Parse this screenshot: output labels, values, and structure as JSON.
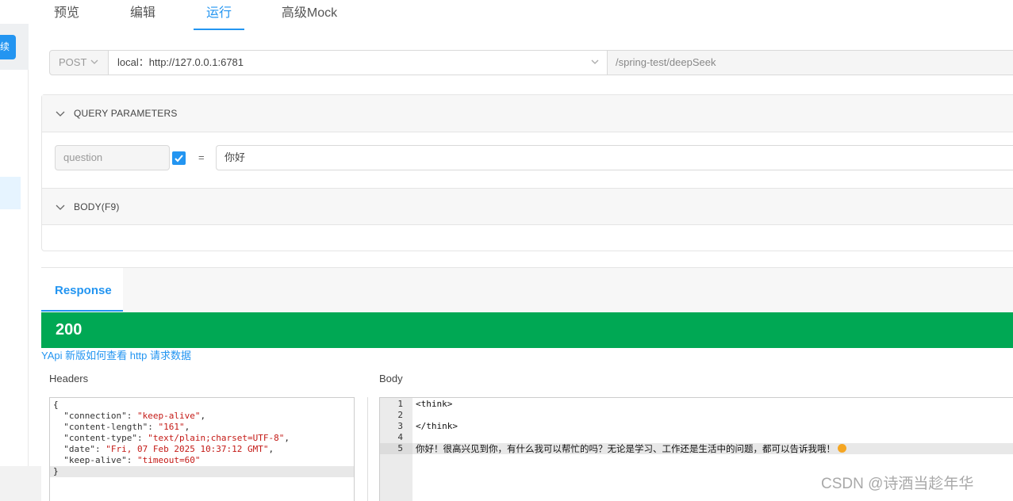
{
  "sidebar": {
    "button_label": "续"
  },
  "tabs": [
    {
      "label": "预览"
    },
    {
      "label": "编辑"
    },
    {
      "label": "运行"
    },
    {
      "label": "高级Mock"
    }
  ],
  "request": {
    "method": "POST",
    "host": "local：http://127.0.0.1:6781",
    "path": "/spring-test/deepSeek"
  },
  "query_section": {
    "title": "QUERY PARAMETERS",
    "param_name": "question",
    "equals": "=",
    "param_value": "你好"
  },
  "body_section": {
    "title": "BODY(F9)"
  },
  "response": {
    "tab_label": "Response",
    "status_code": "200",
    "help_link": "YApi 新版如何查看 http 请求数据",
    "headers_label": "Headers",
    "body_label": "Body",
    "headers": {
      "open": "{",
      "close": "}",
      "entries": [
        {
          "key": "\"connection\": ",
          "value": "\"keep-alive\"",
          "sep": ","
        },
        {
          "key": "\"content-length\": ",
          "value": "\"161\"",
          "sep": ","
        },
        {
          "key": "\"content-type\": ",
          "value": "\"text/plain;charset=UTF-8\"",
          "sep": ","
        },
        {
          "key": "\"date\": ",
          "value": "\"Fri, 07 Feb 2025 10:37:12 GMT\"",
          "sep": ","
        },
        {
          "key": "\"keep-alive\": ",
          "value": "\"timeout=60\"",
          "sep": ""
        }
      ]
    },
    "body_lines": [
      {
        "num": "1",
        "text": "<think>"
      },
      {
        "num": "2",
        "text": ""
      },
      {
        "num": "3",
        "text": "</think>"
      },
      {
        "num": "4",
        "text": ""
      },
      {
        "num": "5",
        "text": "你好！很高兴见到你，有什么我可以帮忙的吗？无论是学习、工作还是生活中的问题，都可以告诉我哦！"
      }
    ]
  },
  "watermark": "CSDN @诗酒当趁年华",
  "colors": {
    "accent": "#2395f1",
    "status_ok": "#00a854"
  }
}
